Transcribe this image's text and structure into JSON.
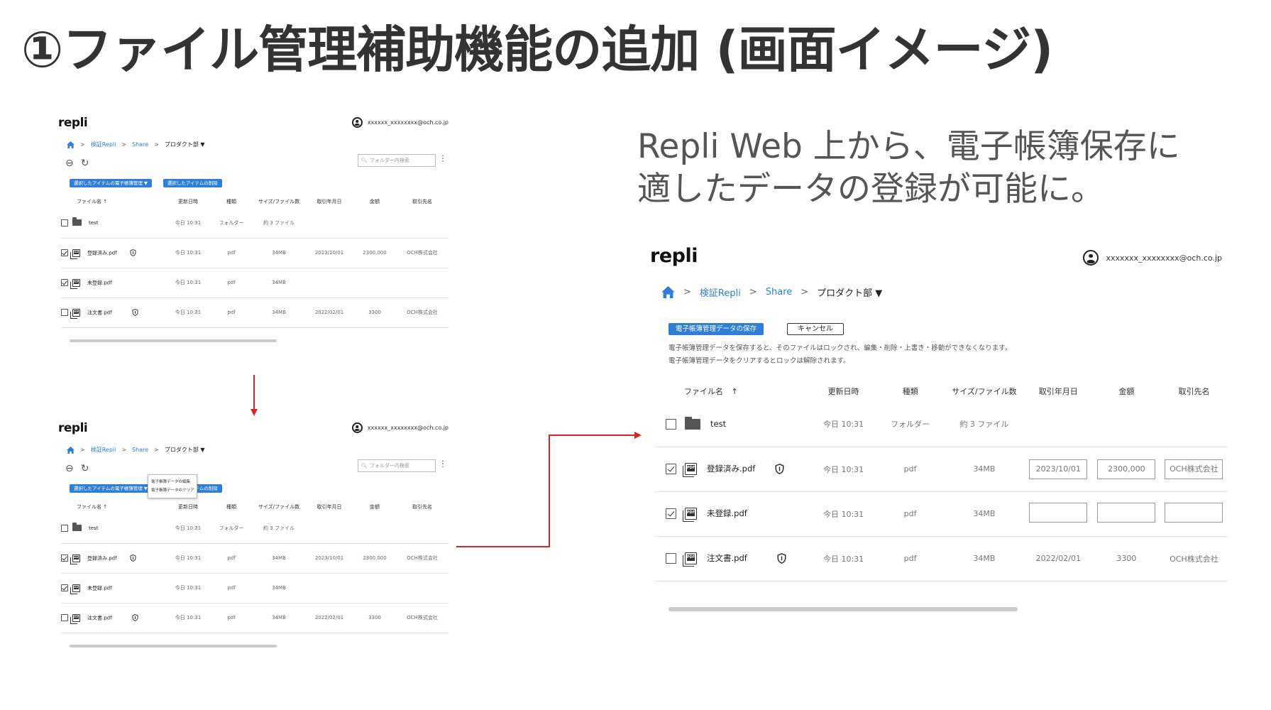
{
  "slide": {
    "title": "①ファイル管理補助機能の追加 (画面イメージ)",
    "caption_line1": "Repli Web 上から、電子帳簿保存に",
    "caption_line2": "適したデータの登録が可能に。"
  },
  "app": {
    "logo": "repli",
    "account_small": "xxxxxx_xxxxxxxx@och.co.jp",
    "account_large": "xxxxxxx_xxxxxxxx@och.co.jp",
    "breadcrumb": [
      "検証Repli",
      "Share",
      "プロダクト部 ▼"
    ],
    "search_placeholder": "フォルダー内検索",
    "bulk_action_ledger": "選択したアイテムの電子帳簿管理 ▼",
    "bulk_action_delete": "選択したアイテムの削除",
    "menu_items": [
      "電子帳簿データの編集",
      "電子帳簿データのクリア"
    ],
    "save_button": "電子帳簿管理データの保存",
    "cancel_button": "キャンセル",
    "notice_line1": "電子帳簿管理データを保存すると、そのファイルはロックされ、編集・削除・上書き・移動ができなくなります。",
    "notice_line2": "電子帳簿管理データをクリアするとロックは解除されます。"
  },
  "table": {
    "columns": [
      "ファイル名",
      "更新日時",
      "種類",
      "サイズ/ファイル数",
      "取引年月日",
      "金額",
      "取引先名"
    ],
    "rows": [
      {
        "name": "test",
        "updated": "今日 10:31",
        "type": "フォルダー",
        "size": "約 3 ファイル",
        "date": "",
        "amount": "",
        "partner": ""
      },
      {
        "name": "登録済み.pdf",
        "updated": "今日 10:31",
        "type": "pdf",
        "size": "34MB",
        "date": "2023/10/01",
        "amount": "2300,000",
        "partner": "OCH株式会社"
      },
      {
        "name": "未登録.pdf",
        "updated": "今日 10:31",
        "type": "pdf",
        "size": "34MB",
        "date": "",
        "amount": "",
        "partner": ""
      },
      {
        "name": "注文書.pdf",
        "updated": "今日 10:31",
        "type": "pdf",
        "size": "34MB",
        "date": "2022/02/01",
        "amount": "3300",
        "partner": "OCH株式会社"
      }
    ]
  },
  "colors": {
    "accent": "#2f7fd6",
    "arrow": "#d9232a",
    "title": "#333333"
  },
  "icons": [
    "home-icon",
    "user-icon",
    "search-icon",
    "back-icon",
    "refresh-icon",
    "kebab-icon",
    "folder-icon",
    "pdf-icon",
    "shield-icon",
    "sort-up-icon"
  ]
}
